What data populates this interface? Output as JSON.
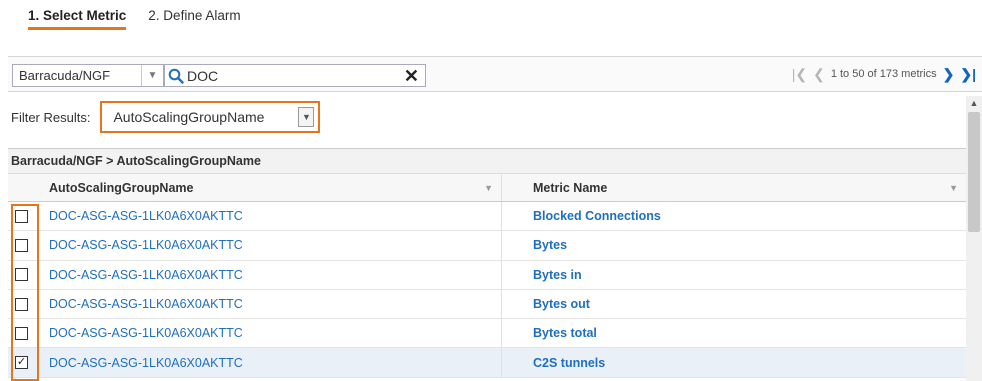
{
  "steps": [
    {
      "label": "1. Select Metric"
    },
    {
      "label": "2. Define Alarm"
    }
  ],
  "toolbar": {
    "namespace": "Barracuda/NGF",
    "search_value": "DOC",
    "pagination": "1 to 50 of 173 metrics"
  },
  "filter": {
    "label": "Filter Results:",
    "selected": "AutoScalingGroupName"
  },
  "table": {
    "caption": "Barracuda/NGF > AutoScalingGroupName",
    "columns": [
      "AutoScalingGroupName",
      "Metric Name"
    ],
    "rows": [
      {
        "asg": "DOC-ASG-ASG-1LK0A6X0AKTTC",
        "metric": "Blocked Connections",
        "checked": false
      },
      {
        "asg": "DOC-ASG-ASG-1LK0A6X0AKTTC",
        "metric": "Bytes",
        "checked": false
      },
      {
        "asg": "DOC-ASG-ASG-1LK0A6X0AKTTC",
        "metric": "Bytes in",
        "checked": false
      },
      {
        "asg": "DOC-ASG-ASG-1LK0A6X0AKTTC",
        "metric": "Bytes out",
        "checked": false
      },
      {
        "asg": "DOC-ASG-ASG-1LK0A6X0AKTTC",
        "metric": "Bytes total",
        "checked": false
      },
      {
        "asg": "DOC-ASG-ASG-1LK0A6X0AKTTC",
        "metric": "C2S tunnels",
        "checked": true
      }
    ]
  },
  "colors": {
    "accent": "#e6761e",
    "link": "#1f6fbf",
    "selected_row": "#e9f0f8"
  },
  "icons": {
    "search": "search-icon",
    "clear": "close-icon",
    "first_page": "first-page-icon",
    "prev_page": "prev-page-icon",
    "next_page": "next-page-icon",
    "last_page": "last-page-icon"
  }
}
